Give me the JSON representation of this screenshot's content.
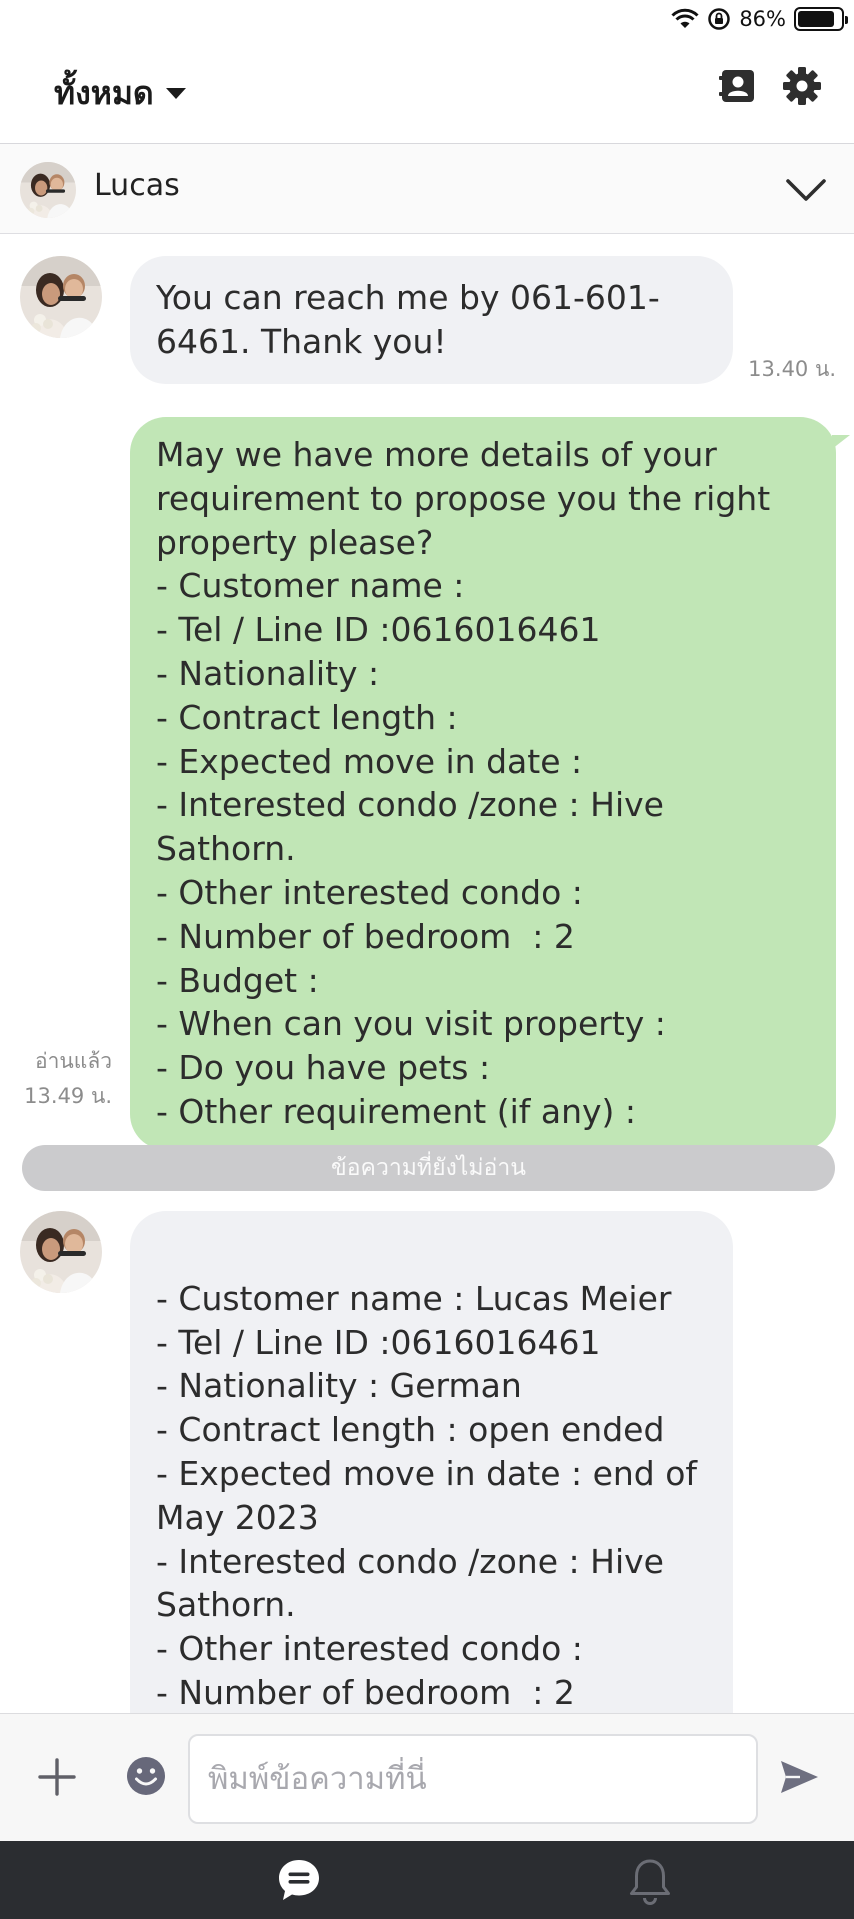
{
  "status_bar": {
    "battery_percent": "86%",
    "battery_level": 0.86
  },
  "header": {
    "folder_label": "ทั้งหมด"
  },
  "conversation": {
    "name": "Lucas"
  },
  "messages": [
    {
      "type": "incoming",
      "text": "You can reach me by 061-601-6461. Thank you!",
      "time": "13.40 น."
    },
    {
      "type": "outgoing",
      "text": "May we have more details of your requirement to propose you the right property please?\n- Customer name :\n- Tel / Line ID :0616016461\n- Nationality :\n- Contract length :\n- Expected move in date :\n- Interested condo /zone : Hive Sathorn.\n- Other interested condo :\n- Number of bedroom  : 2\n- Budget :\n- When can you visit property :\n- Do you have pets :\n- Other requirement (if any) :",
      "read_label": "อ่านแล้ว",
      "time": "13.49 น."
    },
    {
      "type": "incoming",
      "text": "\n- Customer name : Lucas Meier\n- Tel / Line ID :0616016461\n- Nationality : German\n- Contract length : open ended\n- Expected move in date : end of May 2023\n- Interested condo /zone : Hive Sathorn.\n- Other interested condo :\n- Number of bedroom  : 2"
    }
  ],
  "unread_divider": "ข้อความที่ยังไม่อ่าน",
  "composer": {
    "placeholder": "พิมพ์ข้อความที่นี่",
    "value": ""
  },
  "icons": {
    "status": [
      "wifi-icon",
      "orientation-lock-icon",
      "battery-icon"
    ],
    "header": [
      "contacts-icon",
      "settings-icon"
    ],
    "composer": [
      "plus-icon",
      "emoji-icon",
      "send-icon"
    ],
    "nav": [
      "chat-icon",
      "bell-icon"
    ]
  },
  "colors": {
    "outgoing_bubble": "#c1e6b6",
    "incoming_bubble": "#f0f1f4",
    "nav_background": "#2b2d31",
    "unread_divider": "#cbcbcd"
  }
}
